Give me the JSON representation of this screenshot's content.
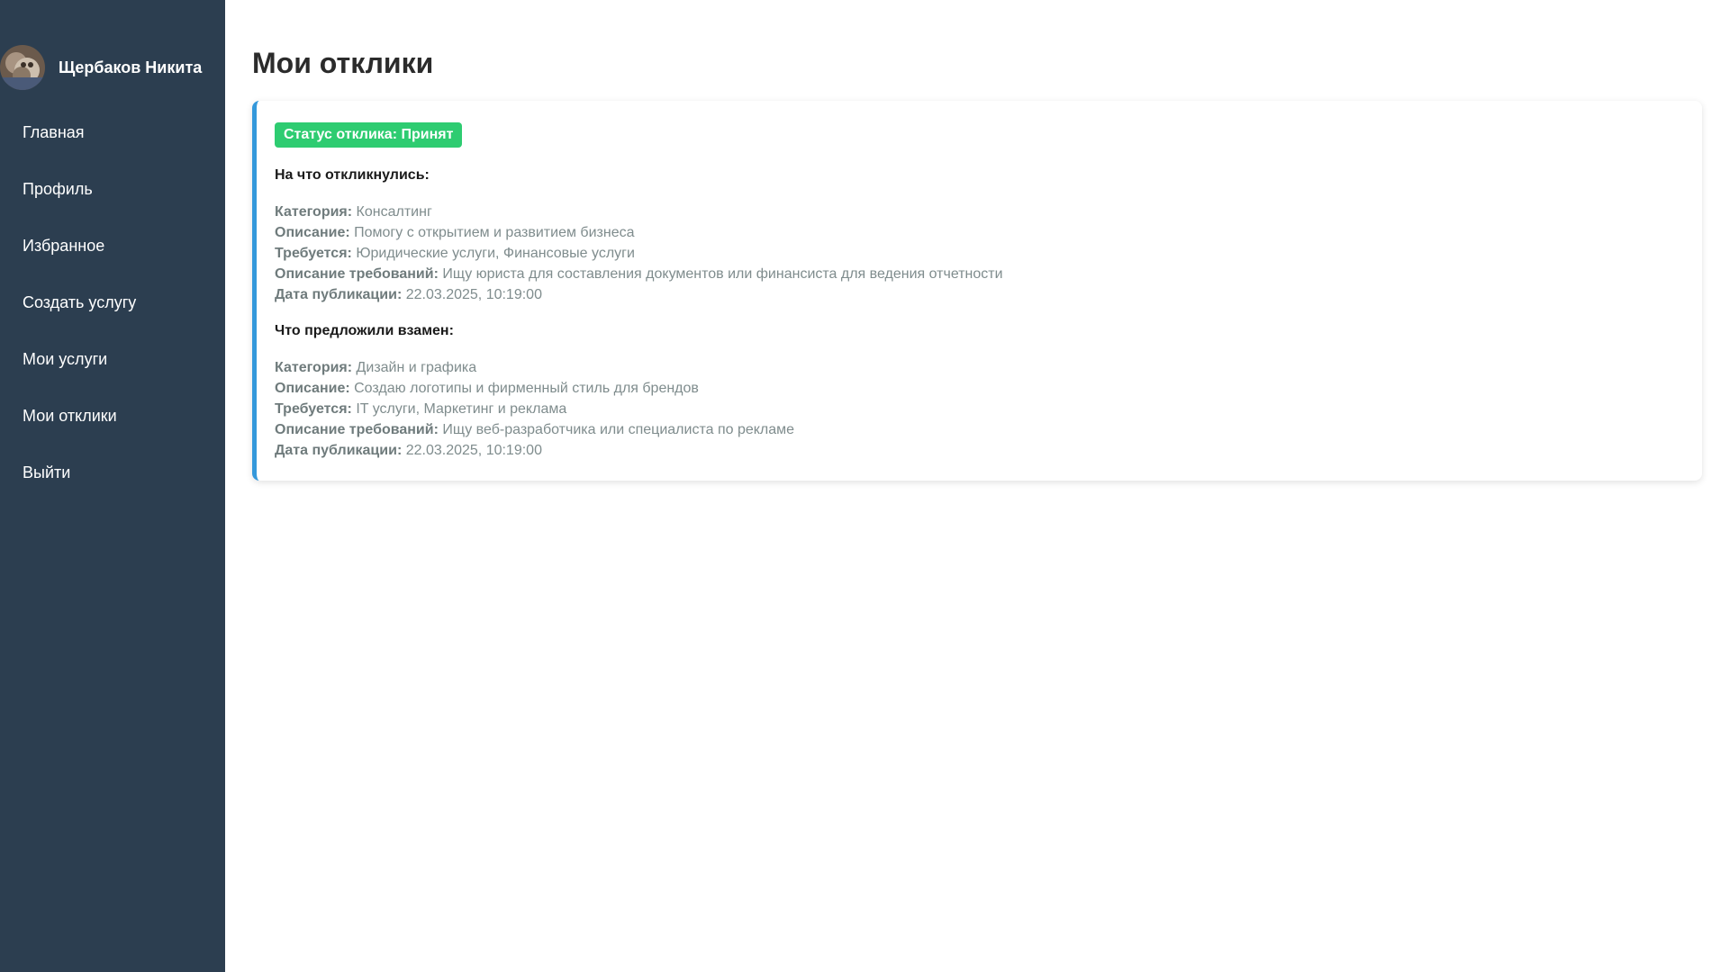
{
  "sidebar": {
    "user_name": "Щербаков Никита",
    "items": [
      {
        "label": "Главная"
      },
      {
        "label": "Профиль"
      },
      {
        "label": "Избранное"
      },
      {
        "label": "Создать услугу"
      },
      {
        "label": "Мои услуги"
      },
      {
        "label": "Мои отклики"
      },
      {
        "label": "Выйти"
      }
    ]
  },
  "main": {
    "title": "Мои отклики",
    "response": {
      "status": "Статус отклика: Принят",
      "target": {
        "title": "На что откликнулись:",
        "category_label": "Категория:",
        "category": "Консалтинг",
        "description_label": "Описание:",
        "description": "Помогу с открытием и развитием бизнеса",
        "required_label": "Требуется:",
        "required": "Юридические услуги, Финансовые услуги",
        "requirements_label": "Описание требований:",
        "requirements": "Ищу юриста для составления документов или финансиста для ведения отчетности",
        "date_label": "Дата публикации:",
        "date": "22.03.2025, 10:19:00"
      },
      "offer": {
        "title": "Что предложили взамен:",
        "category_label": "Категория:",
        "category": "Дизайн и графика",
        "description_label": "Описание:",
        "description": "Создаю логотипы и фирменный стиль для брендов",
        "required_label": "Требуется:",
        "required": "IT услуги, Маркетинг и реклама",
        "requirements_label": "Описание требований:",
        "requirements": "Ищу веб-разработчика или специалиста по рекламе",
        "date_label": "Дата публикации:",
        "date": "22.03.2025, 10:19:00"
      }
    }
  },
  "colors": {
    "sidebar_bg": "#2c3e50",
    "accent": "#3498db",
    "status_success": "#2ecc71",
    "muted_text": "#7f8c8d"
  }
}
